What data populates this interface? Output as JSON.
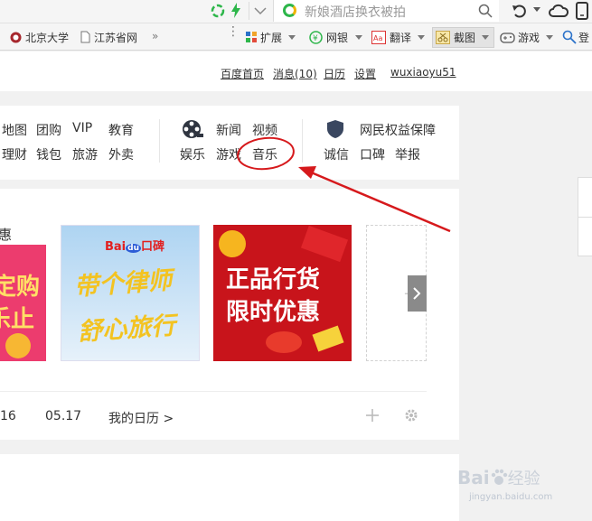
{
  "browser": {
    "search_placeholder": "新娘酒店换衣被拍",
    "bookmarks": [
      "北京大学",
      "江苏省网"
    ],
    "more": "»",
    "tools": [
      "扩展",
      "网银",
      "翻译",
      "截图",
      "游戏",
      "登"
    ]
  },
  "userbar": {
    "links": [
      "百度首页",
      "消息(10)",
      "日历",
      "设置",
      "wuxiaoyu51"
    ]
  },
  "nav": {
    "group1_row1": [
      "地图",
      "团购",
      "VIP",
      "教育"
    ],
    "group1_row2": [
      "理财",
      "钱包",
      "旅游",
      "外卖"
    ],
    "group2_row1": [
      "新闻",
      "视频"
    ],
    "group2_row2": [
      "娱乐",
      "游戏",
      "音乐"
    ],
    "group3_row1": "网民权益保障",
    "group3_row2": [
      "诚信",
      "口碑",
      "举报"
    ]
  },
  "banners": {
    "left_partial": [
      "惠",
      "定购",
      "乐止"
    ],
    "lawyer": {
      "brand": "Bai",
      "brand_du": "du",
      "brand_suffix": "口碑",
      "line1": "带个律师",
      "line2": "舒心旅行"
    },
    "sale": {
      "line1": "正品行货",
      "line2": "限时优惠"
    }
  },
  "calendar": {
    "date_partial": "16",
    "date": "05.17",
    "my_calendar": "我的日历 >"
  },
  "watermark": {
    "brand": "Bai",
    "brand_du": "du",
    "suffix": "经验",
    "url": "jingyan.baidu.com"
  },
  "colors": {
    "highlight": "#d6191c",
    "accent_green": "#2db64a"
  }
}
